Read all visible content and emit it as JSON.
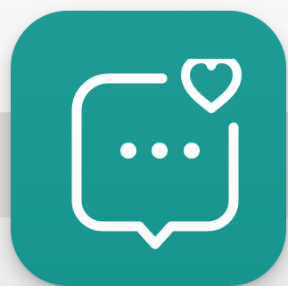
{
  "app_icon": {
    "name": "chat-heart-app",
    "icon": "chat-bubble-heart-icon",
    "background_color": "#179891",
    "glyph_color": "#ffffff",
    "backdrop_color": "#d9d9d9"
  }
}
